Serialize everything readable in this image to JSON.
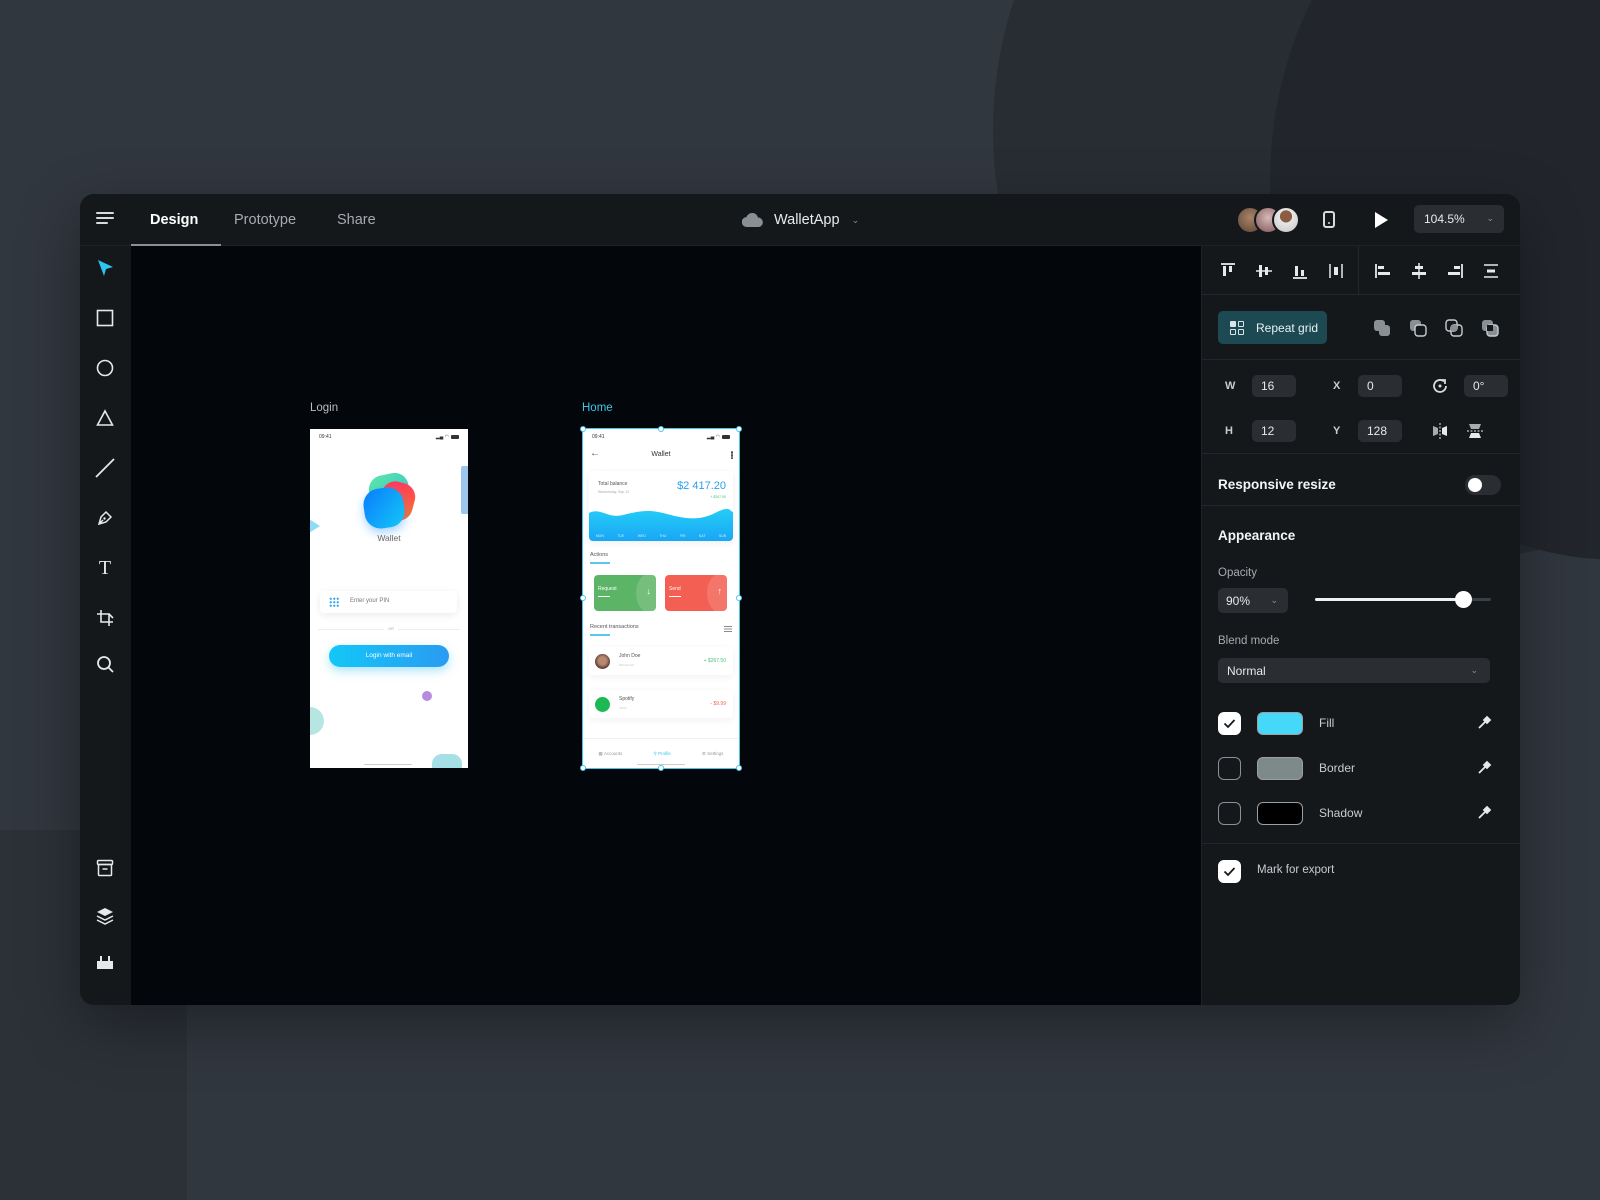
{
  "header": {
    "tabs": [
      {
        "label": "Design",
        "active": true
      },
      {
        "label": "Prototype",
        "active": false
      },
      {
        "label": "Share",
        "active": false
      }
    ],
    "project_name": "WalletApp",
    "zoom_level": "104.5%",
    "collaborators": 3
  },
  "toolbar": {
    "tools": [
      "select",
      "rectangle",
      "ellipse",
      "triangle",
      "line",
      "pen",
      "text",
      "artboard",
      "zoom"
    ],
    "bottom_tools": [
      "assets",
      "layers",
      "plugins"
    ],
    "active_tool": "select",
    "accent": "#2ec4f1"
  },
  "canvas": {
    "artboards": [
      {
        "label": "Login",
        "selected": false,
        "status_time": "09:41",
        "app_title": "Wallet",
        "pin_placeholder": "Enter your PIN",
        "divider_text": "OR",
        "login_button": "Login with email"
      },
      {
        "label": "Home",
        "selected": true,
        "status_time": "09:41",
        "screen_title": "Wallet",
        "balance_label": "Total balance",
        "balance_date": "Wednesday, Sep 12",
        "balance_amount": "$2 417.20",
        "balance_delta": "+ $267.50",
        "days": [
          "MON",
          "TUE",
          "WED",
          "THU",
          "FRI",
          "SAT",
          "SUN"
        ],
        "actions_title": "Actions",
        "actions": [
          {
            "label": "Request",
            "arrow": "↓",
            "color": "#5cb466"
          },
          {
            "label": "Send",
            "arrow": "↑",
            "color": "#f35f52"
          }
        ],
        "transactions_title": "Recent transactions",
        "transactions": [
          {
            "name": "John Doe",
            "type": "RECEIVED",
            "amount": "+ $267.50",
            "color": "#4dc07a"
          },
          {
            "name": "Spotify",
            "type": "SENT",
            "amount": "- $9.99",
            "color": "#f35f52"
          }
        ],
        "nav": [
          {
            "label": "Accounts",
            "active": false
          },
          {
            "label": "Profile",
            "active": true
          },
          {
            "label": "Settings",
            "active": false
          }
        ]
      }
    ]
  },
  "panel": {
    "repeat_grid_label": "Repeat grid",
    "fields": {
      "w_label": "W",
      "w": "16",
      "h_label": "H",
      "h": "12",
      "x_label": "X",
      "x": "0",
      "y_label": "Y",
      "y": "128",
      "rotation": "0°"
    },
    "responsive_resize": {
      "label": "Responsive resize",
      "enabled": false
    },
    "appearance": {
      "title": "Appearance",
      "opacity_label": "Opacity",
      "opacity_value": "90%",
      "opacity_slider_fraction": 0.84,
      "blend_label": "Blend mode",
      "blend_value": "Normal",
      "fills": [
        {
          "label": "Fill",
          "checked": true,
          "color": "#45d8f8"
        },
        {
          "label": "Border",
          "checked": false,
          "color": "#7e8a8a"
        },
        {
          "label": "Shadow",
          "checked": false,
          "color": "#000000"
        }
      ]
    },
    "export": {
      "label": "Mark for export",
      "checked": true
    }
  }
}
